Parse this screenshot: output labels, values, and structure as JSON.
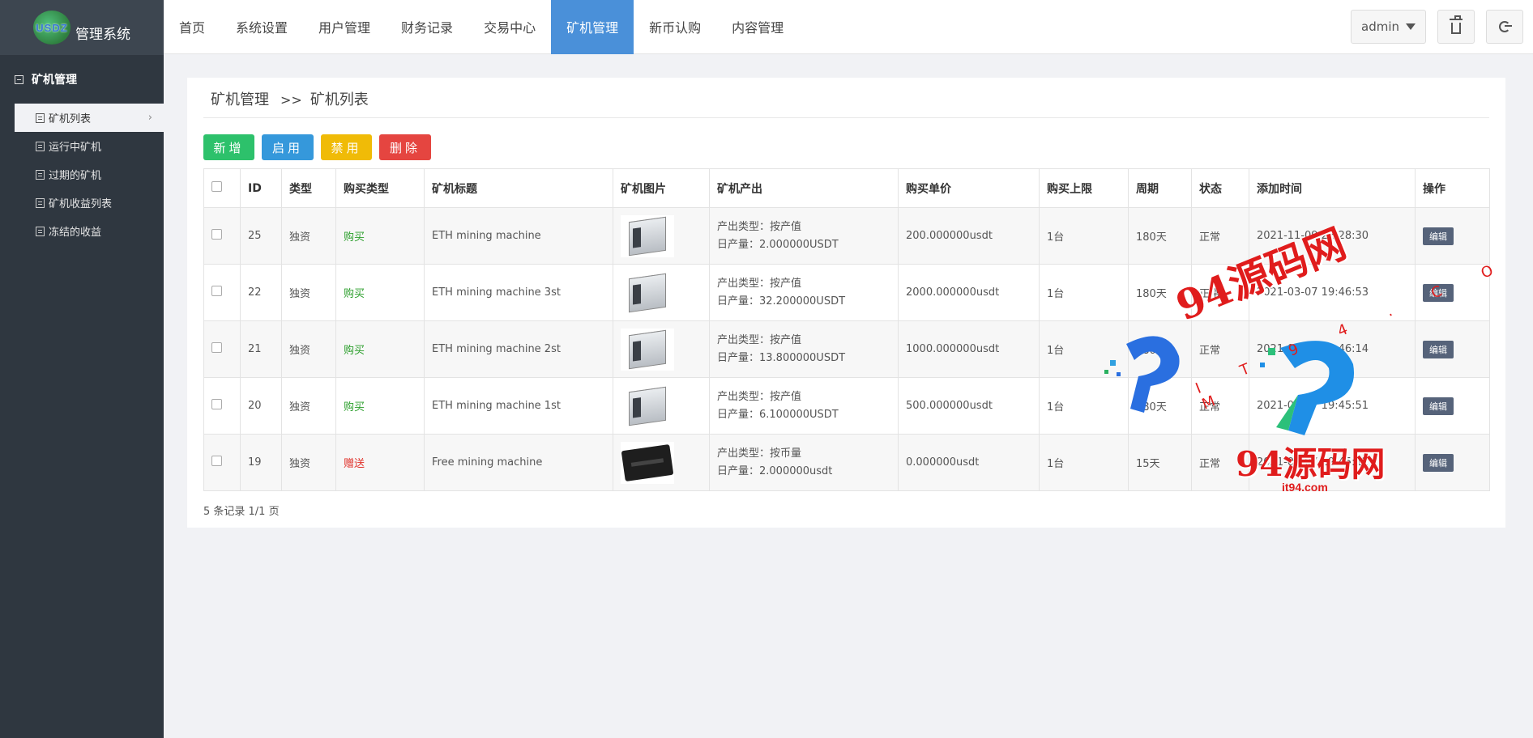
{
  "brand": {
    "logo_text": "USDZ",
    "system_name": "管理系统"
  },
  "nav": {
    "items": [
      "首页",
      "系统设置",
      "用户管理",
      "财务记录",
      "交易中心",
      "矿机管理",
      "新币认购",
      "内容管理"
    ],
    "active_index": 5
  },
  "user": {
    "name": "admin"
  },
  "sidebar": {
    "section": "矿机管理",
    "items": [
      "矿机列表",
      "运行中矿机",
      "过期的矿机",
      "矿机收益列表",
      "冻结的收益"
    ],
    "active_index": 0
  },
  "breadcrumb": {
    "parent": "矿机管理",
    "separator": ">>",
    "current": "矿机列表"
  },
  "actions": {
    "add": "新增",
    "enable": "启用",
    "disable": "禁用",
    "delete": "删除"
  },
  "table": {
    "headers": [
      "ID",
      "类型",
      "购买类型",
      "矿机标题",
      "矿机图片",
      "矿机产出",
      "购买单价",
      "购买上限",
      "周期",
      "状态",
      "添加时间",
      "操作"
    ],
    "rows": [
      {
        "id": "25",
        "type": "独资",
        "buy_type": "购买",
        "title": "ETH mining machine",
        "image": "miner",
        "out_type": "产出类型：按产值",
        "daily": "日产量：2.000000USDT",
        "price": "200.000000usdt",
        "limit": "1台",
        "period": "180天",
        "status": "正常",
        "added": "2021-11-09 22:28:30",
        "op": "编辑"
      },
      {
        "id": "22",
        "type": "独资",
        "buy_type": "购买",
        "title": "ETH mining machine 3st",
        "image": "miner",
        "out_type": "产出类型：按产值",
        "daily": "日产量：32.200000USDT",
        "price": "2000.000000usdt",
        "limit": "1台",
        "period": "180天",
        "status": "正常",
        "added": "2021-03-07 19:46:53",
        "op": "编辑"
      },
      {
        "id": "21",
        "type": "独资",
        "buy_type": "购买",
        "title": "ETH mining machine 2st",
        "image": "miner",
        "out_type": "产出类型：按产值",
        "daily": "日产量：13.800000USDT",
        "price": "1000.000000usdt",
        "limit": "1台",
        "period": "180天",
        "status": "正常",
        "added": "2021-03-07 19:46:14",
        "op": "编辑"
      },
      {
        "id": "20",
        "type": "独资",
        "buy_type": "购买",
        "title": "ETH mining machine 1st",
        "image": "miner",
        "out_type": "产出类型：按产值",
        "daily": "日产量：6.100000USDT",
        "price": "500.000000usdt",
        "limit": "1台",
        "period": "180天",
        "status": "正常",
        "added": "2021-03-07 19:45:51",
        "op": "编辑"
      },
      {
        "id": "19",
        "type": "独资",
        "buy_type": "赠送",
        "title": "Free mining machine",
        "image": "box",
        "out_type": "产出类型：按币量",
        "daily": "日产量：2.000000usdt",
        "price": "0.000000usdt",
        "limit": "1台",
        "period": "15天",
        "status": "正常",
        "added": "2021-03-07 19:45:12",
        "op": "编辑"
      }
    ]
  },
  "pagination": {
    "summary": "5 条记录 1/1 页"
  },
  "watermark": {
    "text1": "94源码网",
    "dots": "I T 9 4 . C O M",
    "text2": "94源码网",
    "url": "it94.com"
  },
  "colors": {
    "sidebar": "#2f3740",
    "nav_active": "#4a90d9",
    "add": "#2dc16b",
    "enable": "#3598db",
    "disable": "#f0bb07",
    "delete": "#e54540",
    "watermark": "#e01c1c"
  }
}
